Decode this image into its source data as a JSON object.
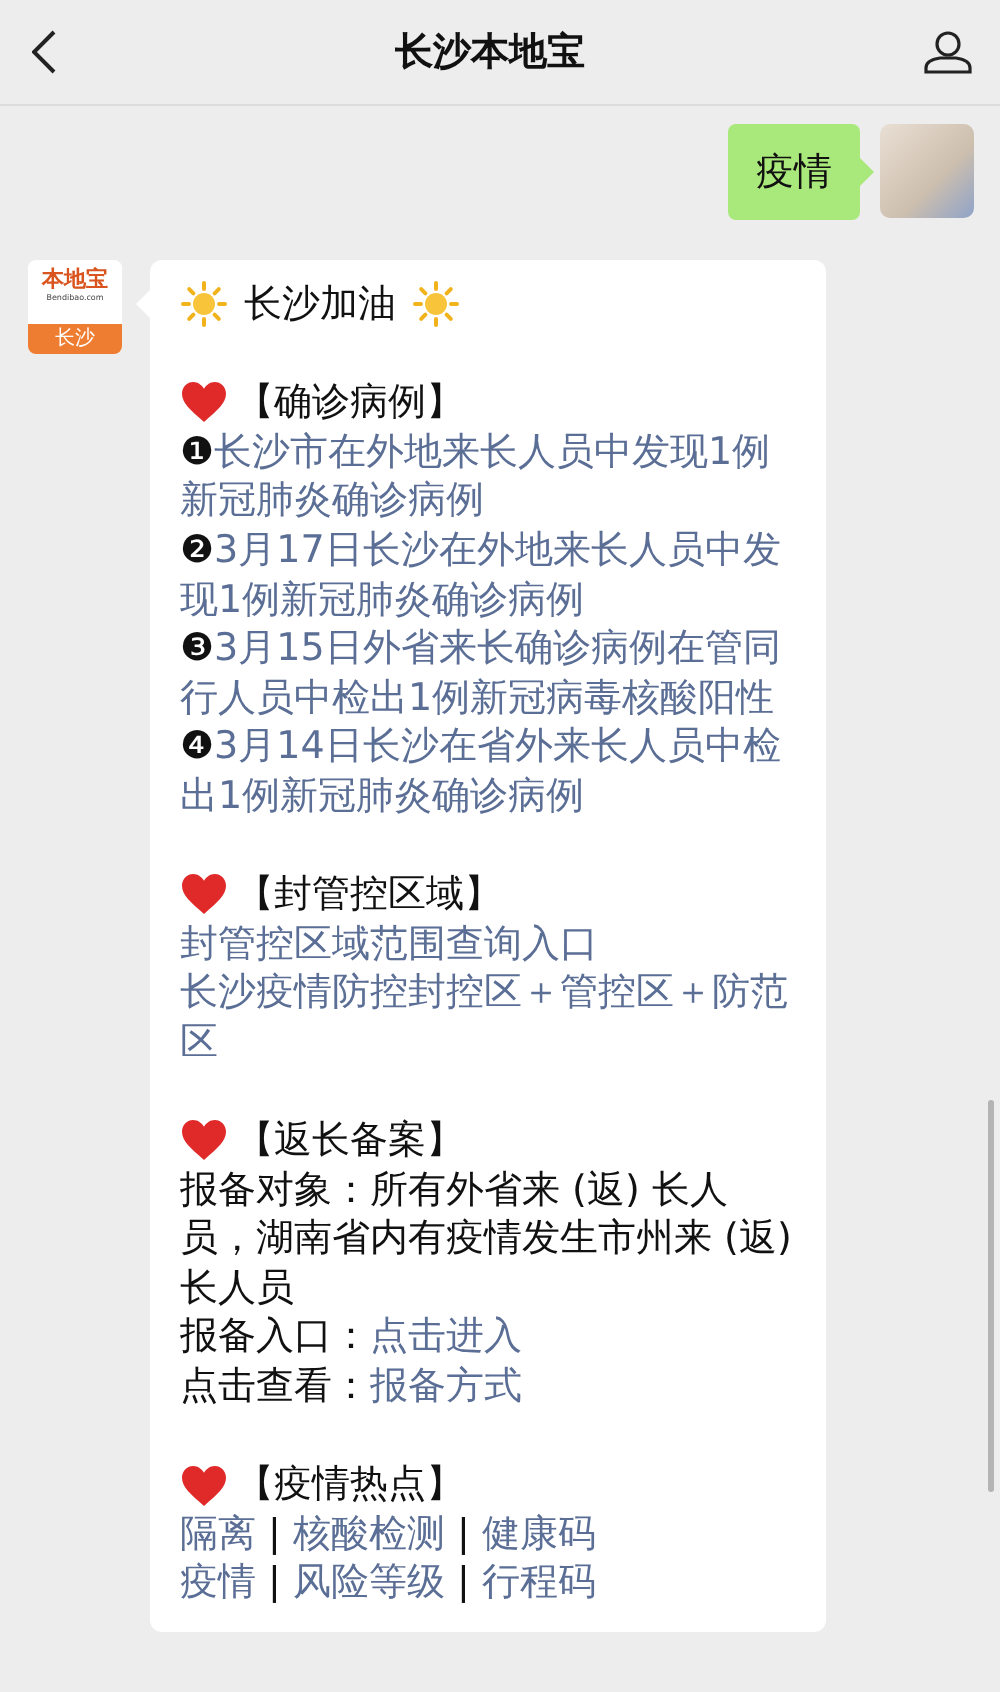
{
  "nav_bar": {
    "title": "长沙本地宝"
  },
  "sent_message": {
    "text": "疫情"
  },
  "reply": {
    "sender_logo": {
      "top": "本地宝",
      "sub": "Bendibao.com",
      "city": "长沙"
    },
    "headline": "长沙加油",
    "sections": [
      {
        "heading": "【确诊病例】",
        "lines": [
          [
            {
              "text": "❶",
              "link": false
            },
            {
              "text": "长沙市在外地来长人员中发现1例新冠肺炎确诊病例",
              "link": true
            }
          ],
          [
            {
              "text": "❷",
              "link": false
            },
            {
              "text": "3月17日长沙在外地来长人员中发现1例新冠肺炎确诊病例",
              "link": true
            }
          ],
          [
            {
              "text": "❸",
              "link": false
            },
            {
              "text": "3月15日外省来长确诊病例在管同行人员中检出1例新冠病毒核酸阳性",
              "link": true
            }
          ],
          [
            {
              "text": "❹",
              "link": false
            },
            {
              "text": "3月14日长沙在省外来长人员中检出1例新冠肺炎确诊病例",
              "link": true
            }
          ]
        ]
      },
      {
        "heading": "【封管控区域】",
        "lines": [
          [
            {
              "text": "封管控区域范围查询入口",
              "link": true
            }
          ],
          [
            {
              "text": "长沙疫情防控封控区＋管控区＋防范区",
              "link": true
            }
          ]
        ]
      },
      {
        "heading": "【返长备案】",
        "lines": [
          [
            {
              "text": "报备对象：所有外省来 (返) 长人员，湖南省内有疫情发生市州来 (返) 长人员",
              "link": false
            }
          ],
          [
            {
              "text": "报备入口：",
              "link": false
            },
            {
              "text": "点击进入",
              "link": true
            }
          ],
          [
            {
              "text": "点击查看：",
              "link": false
            },
            {
              "text": "报备方式",
              "link": true
            }
          ]
        ]
      },
      {
        "heading": "【疫情热点】",
        "lines": [
          [
            {
              "text": "隔离",
              "link": true
            },
            {
              "text": " | ",
              "link": false
            },
            {
              "text": "核酸检测",
              "link": true
            },
            {
              "text": " | ",
              "link": false
            },
            {
              "text": "健康码",
              "link": true
            }
          ],
          [
            {
              "text": "疫情",
              "link": true
            },
            {
              "text": " | ",
              "link": false
            },
            {
              "text": "风险等级",
              "link": true
            },
            {
              "text": " | ",
              "link": false
            },
            {
              "text": "行程码",
              "link": true
            }
          ]
        ]
      }
    ]
  }
}
